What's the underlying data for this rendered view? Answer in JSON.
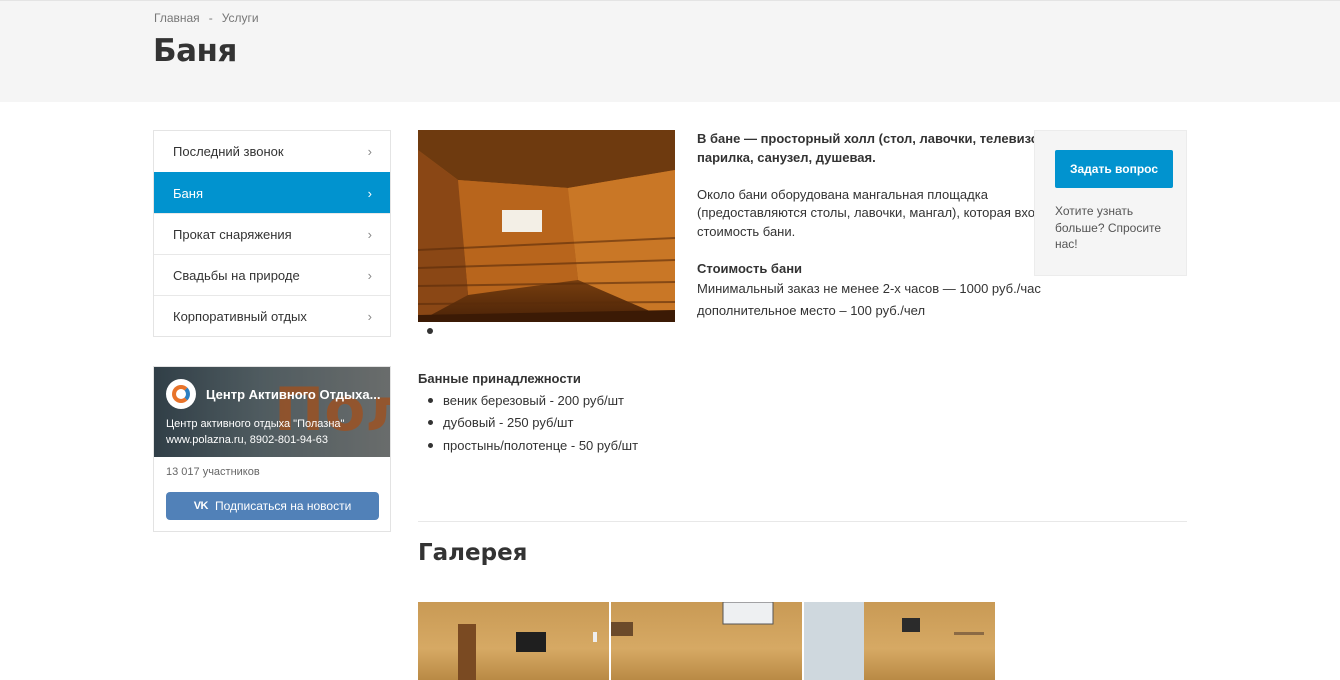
{
  "breadcrumb": {
    "home": "Главная",
    "separator": "-",
    "current": "Услуги"
  },
  "page_title": "Баня",
  "side_menu": {
    "items": [
      {
        "label": "Последний звонок",
        "active": false
      },
      {
        "label": "Баня",
        "active": true
      },
      {
        "label": "Прокат снаряжения",
        "active": false
      },
      {
        "label": "Свадьбы на природе",
        "active": false
      },
      {
        "label": "Корпоративный отдых",
        "active": false
      }
    ]
  },
  "vk_widget": {
    "cover_word": "Полазна",
    "group_name": "Центр Активного Отдыха...",
    "description_line1": "Центр активного отдыха \"Полазна\"",
    "description_line2": "www.polazna.ru, 8902-801-94-63",
    "members": "13 017 участников",
    "subscribe_label": "Подписаться на новости",
    "subscribe_mark": "VK"
  },
  "content": {
    "intro_bold": "В бане — просторный холл (стол, лавочки, телевизор), парилка, санузел, душевая.",
    "bbq_text": "Около бани оборудована мангальная площадка (предоставляются столы, лавочки, мангал), которая входит в стоимость бани.",
    "price_title": "Стоимость бани",
    "price_line1": "Минимальный заказ не менее 2-х часов — 1000 руб./час",
    "price_line2": "дополнительное место – 100 руб./чел"
  },
  "ask_box": {
    "button_label": "Задать вопрос",
    "text": "Хотите узнать больше? Спросите нас!"
  },
  "accessories": {
    "title": "Банные принадлежности",
    "items": [
      "веник березовый - 200 руб/шт",
      "дубовый - 250 руб/шт",
      "простынь/полотенце - 50 руб/шт"
    ]
  },
  "gallery": {
    "title": "Галерея"
  },
  "colors": {
    "accent": "#0193cf",
    "vk_blue": "#5181b8",
    "band_bg": "#f5f5f5"
  }
}
